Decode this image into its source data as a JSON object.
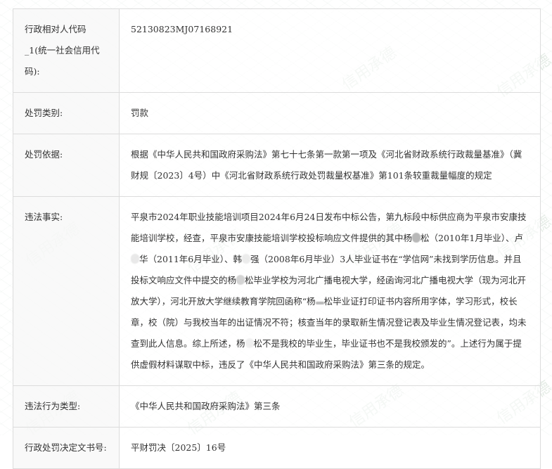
{
  "watermark_text": "信用承德",
  "rows": [
    {
      "label": "行政相对人代码_1(统一社会信用代码):",
      "value": "52130823MJ07168921"
    },
    {
      "label": "处罚类别:",
      "value": "罚款"
    },
    {
      "label": "处罚依据:",
      "value": "根据《中华人民共和国政府采购法》第七十七条第一款第一项及《河北省财政系统行政裁量基准》（冀财规〔2023〕4号）中《河北省财政系统行政处罚裁量权基准》第101条较重裁量幅度的规定"
    },
    {
      "label": "违法事实:",
      "value_parts": [
        "平泉市2024年职业技能培训项目2024年6月24日发布中标公告，第九标段中标供应商为平泉市安康技能培训学校，经查，平泉市安康技能培训学校投标响应文件提供的其中杨",
        "松（2010年1月毕业）、卢",
        "华（2011年6月毕业）、韩",
        "强（2008年6月毕业）3人毕业证书在“学信网”未找到学历信息。并且投标文响应文件中提交的杨",
        "松毕业学校为河北广播电视大学，经函询河北广播电视大学（现为河北开放大学），河北开放大学继续教育学院回函称“杨",
        "松毕业证打印证书内容所用字体，学习形式，校长章，校（院）与我校当年的出证情况不符；核查当年的录取新生情况登记表及毕业生情况登记表，均未查到此人信息。综上所述，杨",
        "松不是我校的毕业生，毕业证书也不是我校颁发的”。上述行为属于提供虚假材料谋取中标，违反了《中华人民共和国政府采购法》第三条的规定。"
      ]
    },
    {
      "label": "违法行为类型:",
      "value": "《中华人民共和国政府采购法》第三条"
    },
    {
      "label": "行政处罚决定文书号:",
      "value": "平财罚决〔2025〕16号"
    }
  ]
}
